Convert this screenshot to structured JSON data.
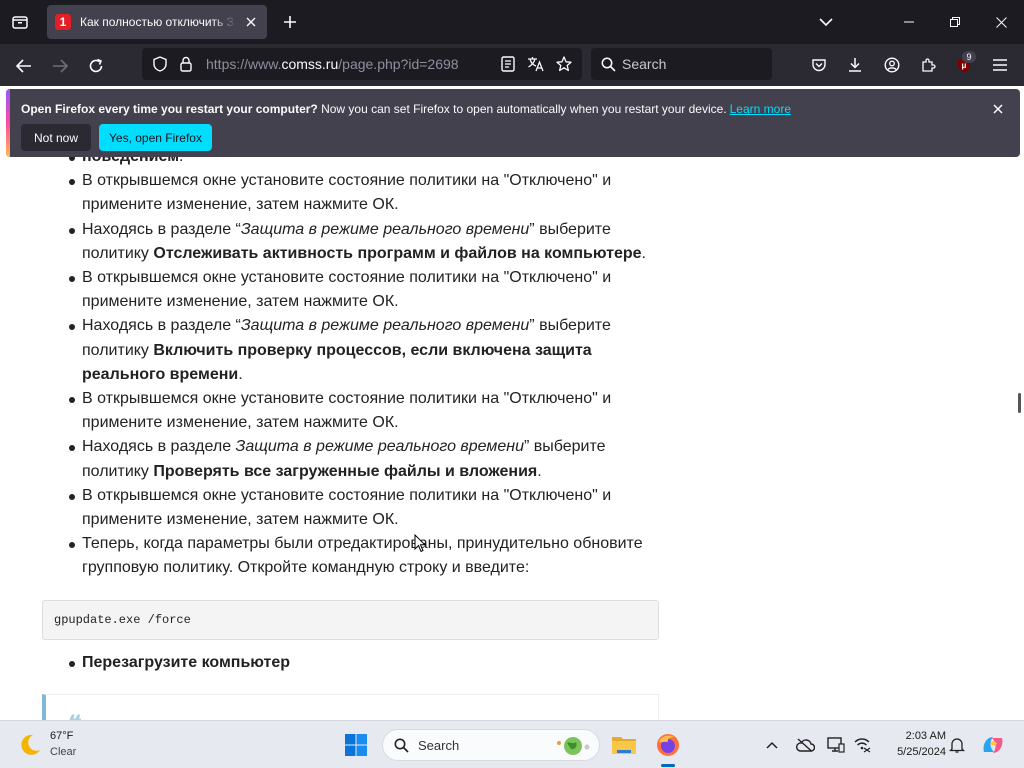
{
  "browser": {
    "tab": {
      "favicon_letter": "1",
      "title": "Как полностью отключить За"
    },
    "window_buttons": [
      "minimize",
      "maximize",
      "close"
    ],
    "url": {
      "scheme": "https://www.",
      "host": "comss.ru",
      "path": "/page.php?id=2698"
    },
    "search_placeholder": "Search",
    "extension_badge": "9",
    "accent_color": "#00ddff"
  },
  "notification": {
    "title": "Open Firefox every time you restart your computer?",
    "message": " Now you can set Firefox to open automatically when you restart your device.",
    "link": "Learn more",
    "secondary_button": "Not now",
    "primary_button": "Yes, open Firefox"
  },
  "article": {
    "items": [
      {
        "parts": [
          {
            "t": "поведением",
            "s": "b"
          },
          {
            "t": ".",
            "s": ""
          }
        ]
      },
      {
        "parts": [
          {
            "t": "В открывшемся окне установите состояние политики на \"Отключено\" и примените изменение, затем нажмите ОК.",
            "s": ""
          }
        ]
      },
      {
        "parts": [
          {
            "t": "Находясь в разделе “",
            "s": ""
          },
          {
            "t": "Защита в режиме реального времени",
            "s": "i"
          },
          {
            "t": "” выберите политику ",
            "s": ""
          },
          {
            "t": "Отслеживать активность программ и файлов на компьютере",
            "s": "b"
          },
          {
            "t": ".",
            "s": ""
          }
        ]
      },
      {
        "parts": [
          {
            "t": "В открывшемся окне установите состояние политики на \"Отключено\" и примените изменение, затем нажмите ОК.",
            "s": ""
          }
        ]
      },
      {
        "parts": [
          {
            "t": "Находясь в разделе “",
            "s": ""
          },
          {
            "t": "Защита в режиме реального времени",
            "s": "i"
          },
          {
            "t": "” выберите политику ",
            "s": ""
          },
          {
            "t": "Включить проверку процессов, если включена защита реального времени",
            "s": "b"
          },
          {
            "t": ".",
            "s": ""
          }
        ]
      },
      {
        "parts": [
          {
            "t": "В открывшемся окне установите состояние политики на \"Отключено\" и примените изменение, затем нажмите ОК.",
            "s": ""
          }
        ]
      },
      {
        "parts": [
          {
            "t": "Находясь в разделе ",
            "s": ""
          },
          {
            "t": "Защита в режиме реального времени",
            "s": "i"
          },
          {
            "t": "” выберите политику ",
            "s": ""
          },
          {
            "t": "Проверять все загруженные файлы и вложения",
            "s": "b"
          },
          {
            "t": ".",
            "s": ""
          }
        ]
      },
      {
        "parts": [
          {
            "t": "В открывшемся окне установите состояние политики на \"Отключено\" и примените изменение, затем нажмите ОК.",
            "s": ""
          }
        ]
      },
      {
        "parts": [
          {
            "t": "Теперь, когда параметры были отредактированы, принудительно обновите групповую политику. Откройте командную строку и введите:",
            "s": ""
          }
        ]
      }
    ],
    "code": "gpupdate.exe /force",
    "final_step": "Перезагрузите компьютер",
    "quote_mark": "❝"
  },
  "taskbar": {
    "weather_temp": "67°F",
    "weather_desc": "Clear",
    "search_placeholder": "Search",
    "time": "2:03 AM",
    "date": "5/25/2024"
  }
}
